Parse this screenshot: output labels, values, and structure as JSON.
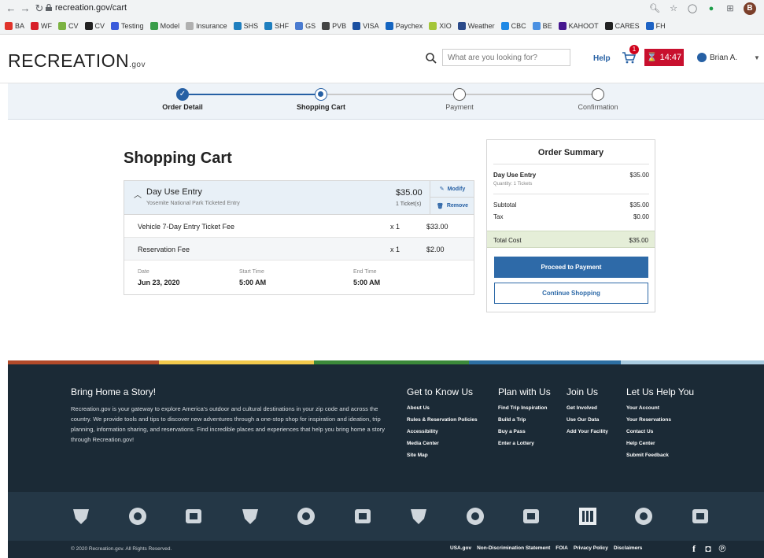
{
  "browser": {
    "url": "recreation.gov/cart",
    "bookmarks": [
      {
        "label": "BA",
        "color": "#e0342b"
      },
      {
        "label": "WF",
        "color": "#d71e28"
      },
      {
        "label": "CV",
        "color": "#7cb342"
      },
      {
        "label": "CV",
        "color": "#222222"
      },
      {
        "label": "Testing",
        "color": "#3b5bdb"
      },
      {
        "label": "Model",
        "color": "#3a9d4a"
      },
      {
        "label": "Insurance",
        "color": "#b0b0b0"
      },
      {
        "label": "SHS",
        "color": "#1f7fbf"
      },
      {
        "label": "SHF",
        "color": "#1f7fbf"
      },
      {
        "label": "GS",
        "color": "#4a7bd0"
      },
      {
        "label": "PVB",
        "color": "#444444"
      },
      {
        "label": "VISA",
        "color": "#1a4fa0"
      },
      {
        "label": "Paychex",
        "color": "#1565c0"
      },
      {
        "label": "XIO",
        "color": "#a4c639"
      },
      {
        "label": "Weather",
        "color": "#2b4a8a"
      },
      {
        "label": "CBC",
        "color": "#1e88e5"
      },
      {
        "label": "BE",
        "color": "#4a90e2"
      },
      {
        "label": "KAHOOT",
        "color": "#46178f"
      },
      {
        "label": "CARES",
        "color": "#222222"
      },
      {
        "label": "FH",
        "color": "#1e63c4"
      }
    ],
    "profile_initial": "B"
  },
  "header": {
    "logo": "RECREATION",
    "logo_suffix": ".gov",
    "search_placeholder": "What are you looking for?",
    "help": "Help",
    "cart_count": "1",
    "timer": "14:47",
    "user": "Brian A."
  },
  "stepper": {
    "steps": [
      {
        "label": "Order Detail",
        "state": "done"
      },
      {
        "label": "Shopping Cart",
        "state": "active"
      },
      {
        "label": "Payment",
        "state": "todo"
      },
      {
        "label": "Confirmation",
        "state": "todo"
      }
    ]
  },
  "cart": {
    "title": "Shopping Cart",
    "item": {
      "name": "Day Use Entry",
      "subtitle": "Yosemite National Park Ticketed Entry",
      "price": "$35.00",
      "qty": "1 Ticket(s)",
      "modify": "Modify",
      "remove": "Remove"
    },
    "fees": [
      {
        "name": "Vehicle 7-Day Entry Ticket Fee",
        "qty": "x 1",
        "amount": "$33.00"
      },
      {
        "name": "Reservation Fee",
        "qty": "x 1",
        "amount": "$2.00"
      }
    ],
    "details": [
      {
        "label": "Date",
        "value": "Jun 23, 2020"
      },
      {
        "label": "Start Time",
        "value": "5:00 AM"
      },
      {
        "label": "End Time",
        "value": "5:00 AM"
      }
    ]
  },
  "summary": {
    "title": "Order Summary",
    "item_name": "Day Use Entry",
    "item_price": "$35.00",
    "item_qty": "Quantity: 1 Tickets",
    "subtotal_label": "Subtotal",
    "subtotal": "$35.00",
    "tax_label": "Tax",
    "tax": "$0.00",
    "total_label": "Total Cost",
    "total": "$35.00",
    "proceed": "Proceed to Payment",
    "continue": "Continue Shopping"
  },
  "footer": {
    "story_title": "Bring Home a Story!",
    "story_body": "Recreation.gov is your gateway to explore America's outdoor and cultural destinations in your zip code and across the country. We provide tools and tips to discover new adventures through a one-stop shop for inspiration and ideation, trip planning, information sharing, and reservations. Find incredible places and experiences that help you bring home a story through Recreation.gov!",
    "columns": [
      {
        "title": "Get to Know Us",
        "links": [
          "About Us",
          "Rules & Reservation Policies",
          "Accessibility",
          "Media Center",
          "Site Map"
        ]
      },
      {
        "title": "Plan with Us",
        "links": [
          "Find Trip Inspiration",
          "Build a Trip",
          "Buy a Pass",
          "Enter a Lottery"
        ]
      },
      {
        "title": "Join Us",
        "links": [
          "Get Involved",
          "Use Our Data",
          "Add Your Facility"
        ]
      },
      {
        "title": "Let Us Help You",
        "links": [
          "Your Account",
          "Your Reservations",
          "Contact Us",
          "Help Center",
          "Submit Feedback"
        ]
      }
    ],
    "copyright": "© 2020 Recreation.gov. All Rights Reserved.",
    "legal_links": [
      "USA.gov",
      "Non-Discrimination Statement",
      "FOIA",
      "Privacy Policy",
      "Disclaimers"
    ],
    "agency_icons": [
      "blm-icon",
      "reclamation-icon",
      "noaa-icon",
      "nara-icon",
      "usace-icon",
      "presidio-icon",
      "fws-icon",
      "nps-icon",
      "treasury-icon",
      "tva-icon",
      "boat-icon",
      "smithsonian-icon"
    ],
    "stripe_colors": [
      "#b24a2a",
      "#f2c94c",
      "#3c8a3a",
      "#2d6fa3",
      "#a9cbe0"
    ]
  }
}
